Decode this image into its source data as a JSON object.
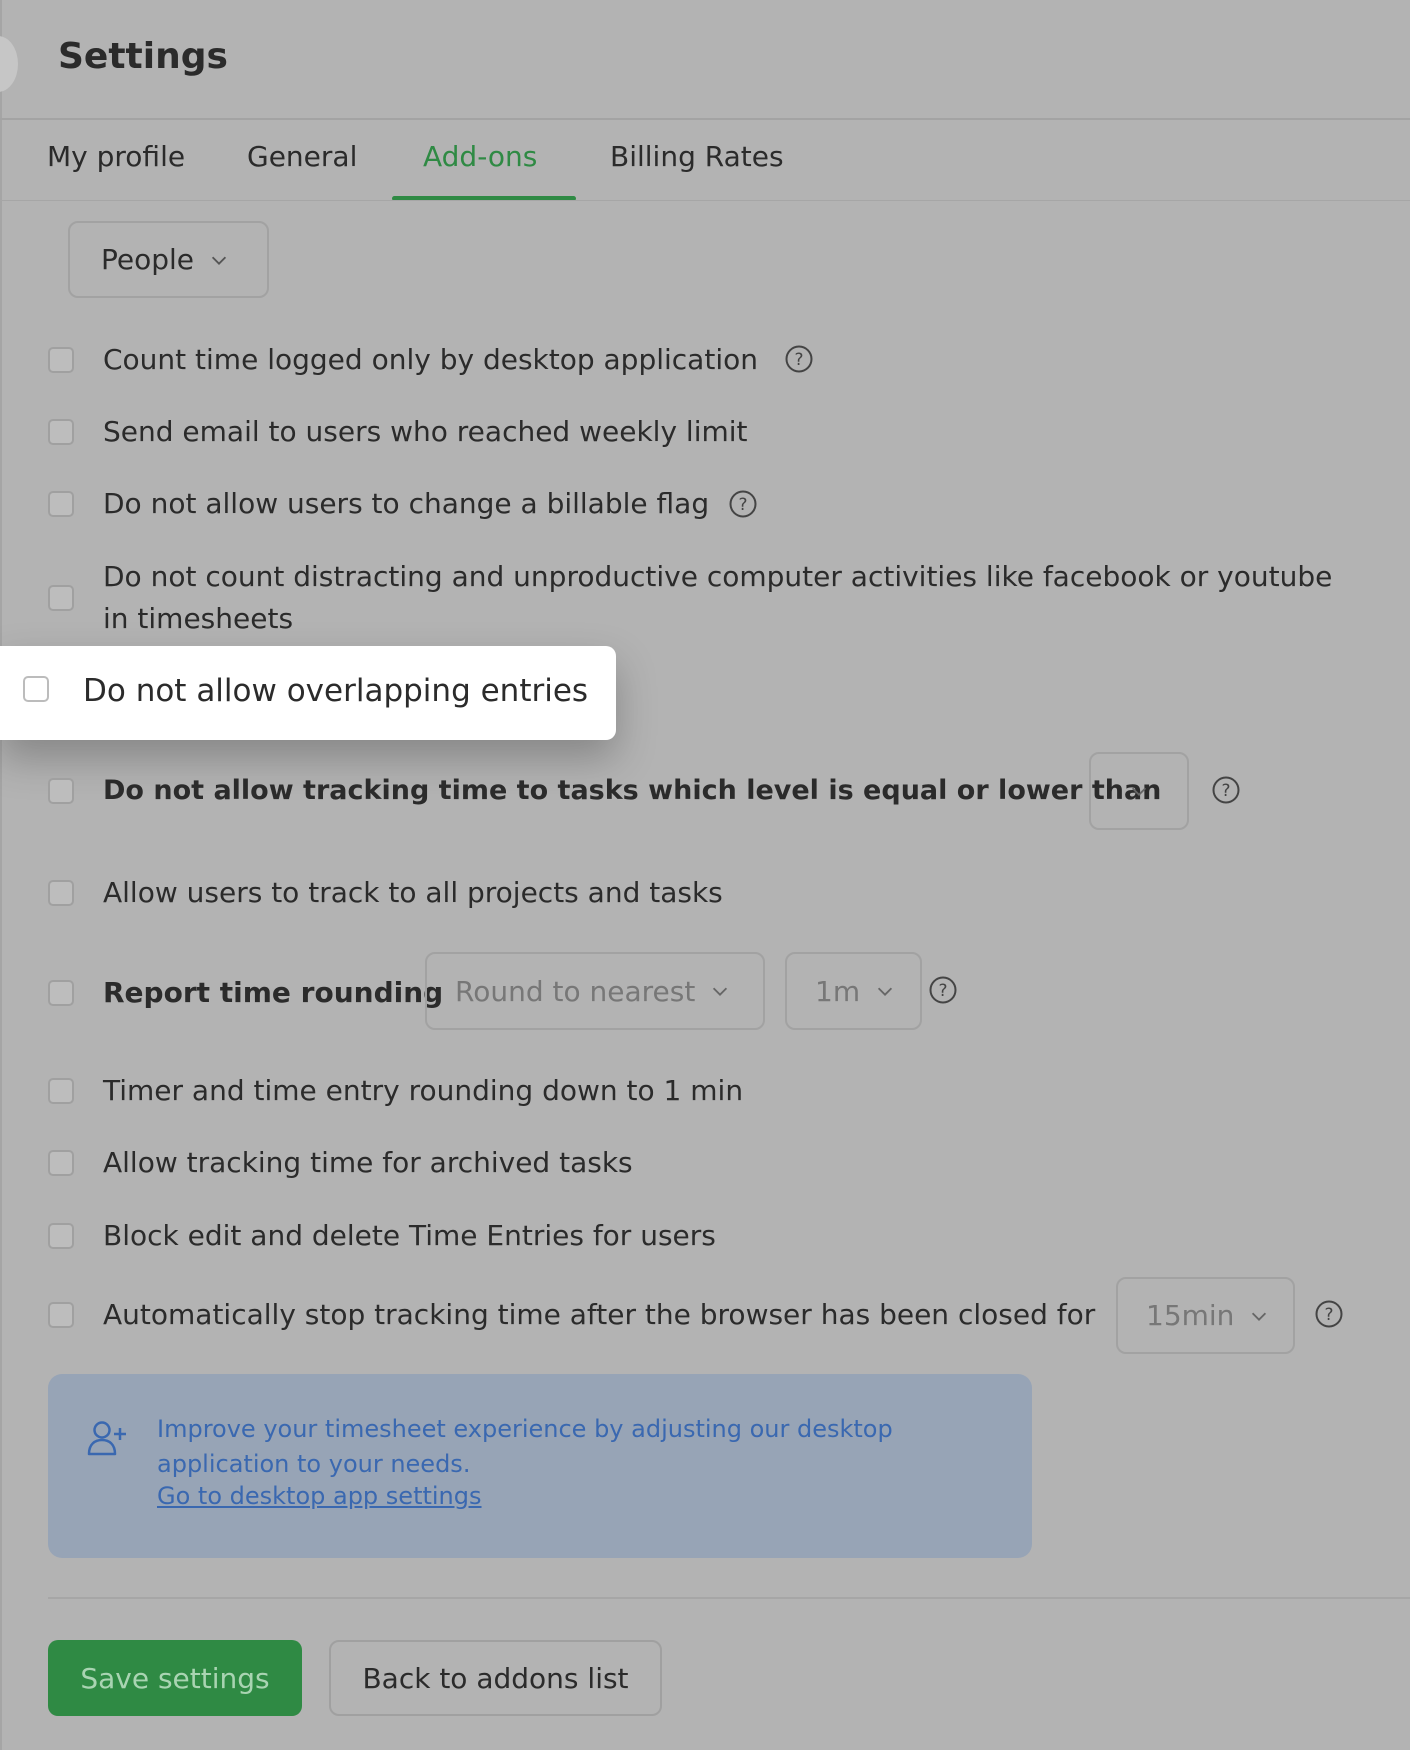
{
  "header": {
    "title": "Settings"
  },
  "tabs": [
    {
      "label": "My profile"
    },
    {
      "label": "General"
    },
    {
      "label": "Add-ons",
      "active": true
    },
    {
      "label": "Billing Rates"
    }
  ],
  "filter": {
    "selected": "People"
  },
  "settings": [
    {
      "label": "Count time logged only by desktop application",
      "checked": false,
      "help": true
    },
    {
      "label": "Send email to users who reached weekly limit",
      "checked": false
    },
    {
      "label": "Do not allow users to change a billable flag",
      "checked": false,
      "help": true
    },
    {
      "label_line1": "Do not count distracting and unproductive computer activities like facebook or youtube",
      "label_line2": "in timesheets",
      "checked": false
    },
    {
      "label": "Do not allow overlapping entries",
      "checked": false,
      "highlighted": true
    },
    {
      "label": "Do not allow tracking time to tasks which level is equal or lower than",
      "checked": false,
      "help": true,
      "select_value": ""
    },
    {
      "label": "Allow users to track to all projects and tasks",
      "checked": false
    },
    {
      "label": "Report time rounding",
      "checked": false,
      "help": true,
      "rounding_mode": "Round to nearest",
      "rounding_step": "1m"
    },
    {
      "label": "Timer and time entry rounding down to 1 min",
      "checked": false
    },
    {
      "label": "Allow tracking time for archived tasks",
      "checked": false
    },
    {
      "label": "Block edit and delete Time Entries for users",
      "checked": false
    },
    {
      "label": "Automatically stop tracking time after the browser has been closed for",
      "checked": false,
      "help": true,
      "select_value": "15min"
    }
  ],
  "info": {
    "text": "Improve your timesheet experience by adjusting our desktop application to your needs.",
    "link": "Go to desktop app settings",
    "icon": "add-user-icon"
  },
  "buttons": {
    "save": "Save settings",
    "back": "Back to addons list"
  },
  "colors": {
    "accent": "#2f8a44",
    "overlay": "#b3b3b3",
    "info_bg": "#97a4b6",
    "link": "#3a68b0"
  }
}
